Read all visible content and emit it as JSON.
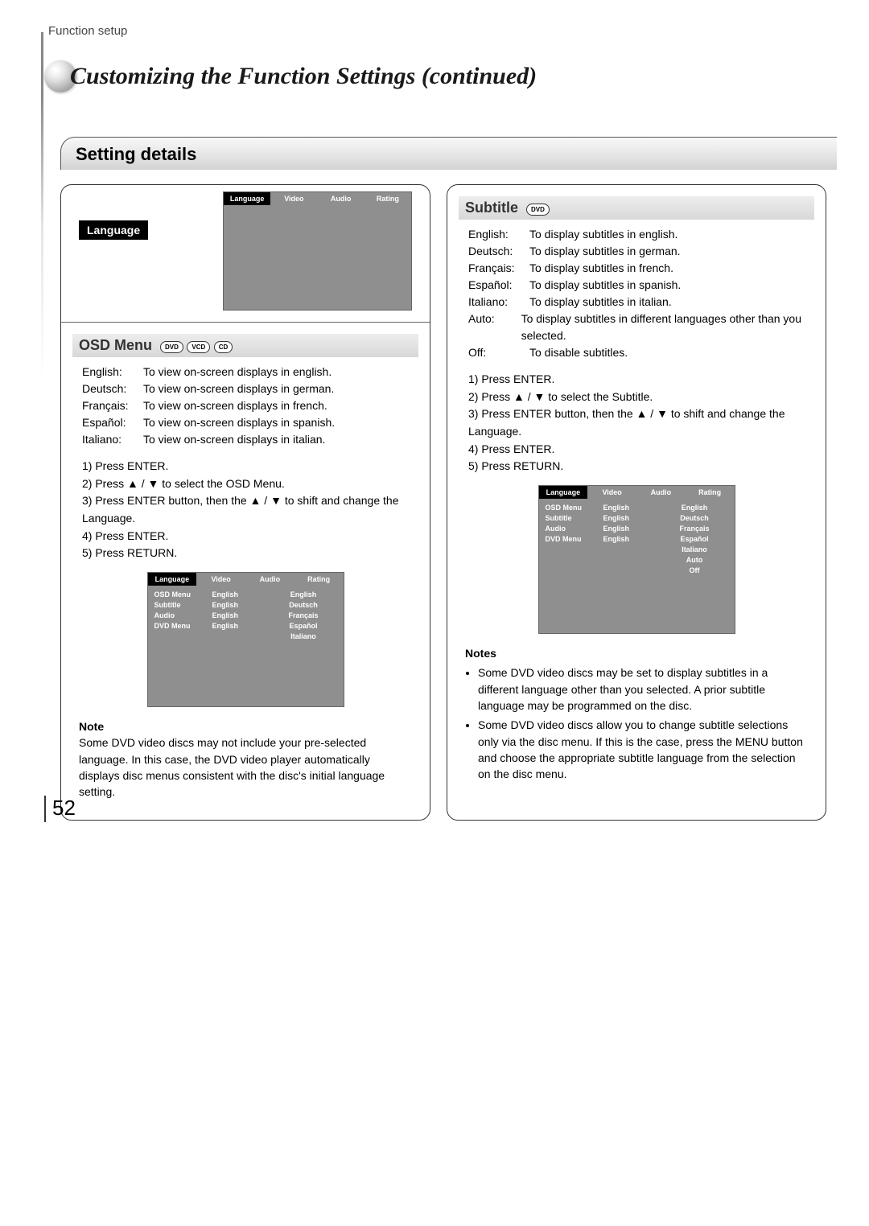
{
  "header": {
    "section_label": "Function setup"
  },
  "chapter": {
    "title": "Customizing the Function Settings (continued)"
  },
  "section": {
    "title": "Setting details"
  },
  "left": {
    "tab": "Language",
    "osd_top": {
      "tabs": [
        "Language",
        "Video",
        "Audio",
        "Rating"
      ],
      "selected_index": 0
    },
    "subheading": "OSD Menu",
    "badges": [
      "DVD",
      "VCD",
      "CD"
    ],
    "lang_rows": [
      {
        "k": "English:",
        "v": "To view on-screen displays in english."
      },
      {
        "k": "Deutsch:",
        "v": "To view on-screen displays in german."
      },
      {
        "k": "Français:",
        "v": "To view on-screen displays in french."
      },
      {
        "k": "Español:",
        "v": "To view on-screen displays in spanish."
      },
      {
        "k": "Italiano:",
        "v": "To view on-screen displays in italian."
      }
    ],
    "steps": [
      "1)  Press ENTER.",
      "2)  Press ▲ / ▼ to select the OSD Menu.",
      "3)  Press ENTER button, then the ▲ / ▼ to shift and change the Language.",
      "4)  Press ENTER.",
      "5)  Press RETURN."
    ],
    "osd_full": {
      "tabs": [
        "Language",
        "Video",
        "Audio",
        "Rating"
      ],
      "selected_index": 0,
      "col1": [
        "OSD Menu",
        "Subtitle",
        "Audio",
        "DVD Menu"
      ],
      "col2": [
        "English",
        "English",
        "English",
        "English"
      ],
      "col3": [
        "English",
        "Deutsch",
        "Français",
        "Español",
        "Italiano"
      ]
    },
    "note_title": "Note",
    "note_text": "Some DVD video discs may not include your pre-selected language. In this case, the DVD video player automatically displays disc menus consistent with the disc's initial language setting."
  },
  "right": {
    "subheading": "Subtitle",
    "badges": [
      "DVD"
    ],
    "lang_rows": [
      {
        "k": "English:",
        "v": "To display subtitles in english."
      },
      {
        "k": "Deutsch:",
        "v": "To display subtitles in german."
      },
      {
        "k": "Français:",
        "v": "To display subtitles in french."
      },
      {
        "k": "Español:",
        "v": "To display subtitles in spanish."
      },
      {
        "k": "Italiano:",
        "v": "To display subtitles in italian."
      },
      {
        "k": "Auto:",
        "v": "To display subtitles in different languages other than you selected."
      },
      {
        "k": "Off:",
        "v": "To disable subtitles."
      }
    ],
    "steps": [
      "1)  Press ENTER.",
      "2)  Press ▲ / ▼ to select the Subtitle.",
      "3)  Press ENTER button, then the ▲ / ▼ to shift and change the Language.",
      "4)  Press ENTER.",
      "5)  Press RETURN."
    ],
    "osd_full": {
      "tabs": [
        "Language",
        "Video",
        "Audio",
        "Rating"
      ],
      "selected_index": 0,
      "col1": [
        "OSD Menu",
        "Subtitle",
        "Audio",
        "DVD Menu"
      ],
      "col2": [
        "English",
        "English",
        "English",
        "English"
      ],
      "col3": [
        "English",
        "Deutsch",
        "Français",
        "Español",
        "Italiano",
        "Auto",
        "Off"
      ]
    },
    "notes_title": "Notes",
    "notes": [
      "Some DVD video discs may be set to display subtitles in a different language other than you selected. A prior subtitle language may be programmed on the disc.",
      "Some DVD video discs allow you to change subtitle selections only via the disc menu. If this is the case, press the MENU button and choose the appropriate subtitle language from the selection on the disc menu."
    ]
  },
  "page_number": "52"
}
